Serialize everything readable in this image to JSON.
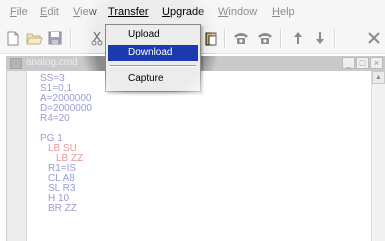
{
  "menubar": {
    "items": [
      "File",
      "Edit",
      "View",
      "Transfer",
      "Upgrade",
      "Window",
      "Help"
    ],
    "active_index": 3
  },
  "toolbar": {
    "icons": [
      "new-file-icon",
      "open-folder-icon",
      "save-icon",
      "cut-icon",
      "paste-icon",
      "phone-icon",
      "hangup-icon",
      "arrow-up-icon",
      "arrow-down-icon",
      "close-icon"
    ]
  },
  "dropdown": {
    "items": [
      {
        "label": "Upload",
        "selected": false
      },
      {
        "label": "Download",
        "selected": true
      },
      {
        "label": "Capture",
        "selected": false
      }
    ]
  },
  "child_window": {
    "title": "analog.cmd",
    "buttons": [
      "_",
      "□",
      "×"
    ]
  },
  "editor": {
    "lines": [
      {
        "text": "SS=3",
        "color": "#1a1aa0"
      },
      {
        "text": "S1=0,1",
        "color": "#1a1aa0"
      },
      {
        "text": "A=2000000",
        "color": "#1a1aa0"
      },
      {
        "text": "D=2000000",
        "color": "#1a1aa0"
      },
      {
        "text": "R4=20",
        "color": "#1a1aa0"
      },
      {
        "text": "",
        "color": "#1a1aa0"
      },
      {
        "text": "PG 1",
        "color": "#1a1aa0"
      },
      {
        "text": "LB SU",
        "color": "#c01818"
      },
      {
        "text": "LB ZZ",
        "color": "#c01818"
      },
      {
        "text": "R1=IS",
        "color": "#1a1aa0"
      },
      {
        "text": "CL A8",
        "color": "#1a1aa0"
      },
      {
        "text": "SL R3",
        "color": "#1a1aa0"
      },
      {
        "text": "H 10",
        "color": "#1a1aa0"
      },
      {
        "text": "BR ZZ",
        "color": "#1a1aa0"
      }
    ]
  },
  "colors": {
    "highlight": "#1a3bb0",
    "keyword": "#1a1aa0",
    "label": "#c01818"
  }
}
